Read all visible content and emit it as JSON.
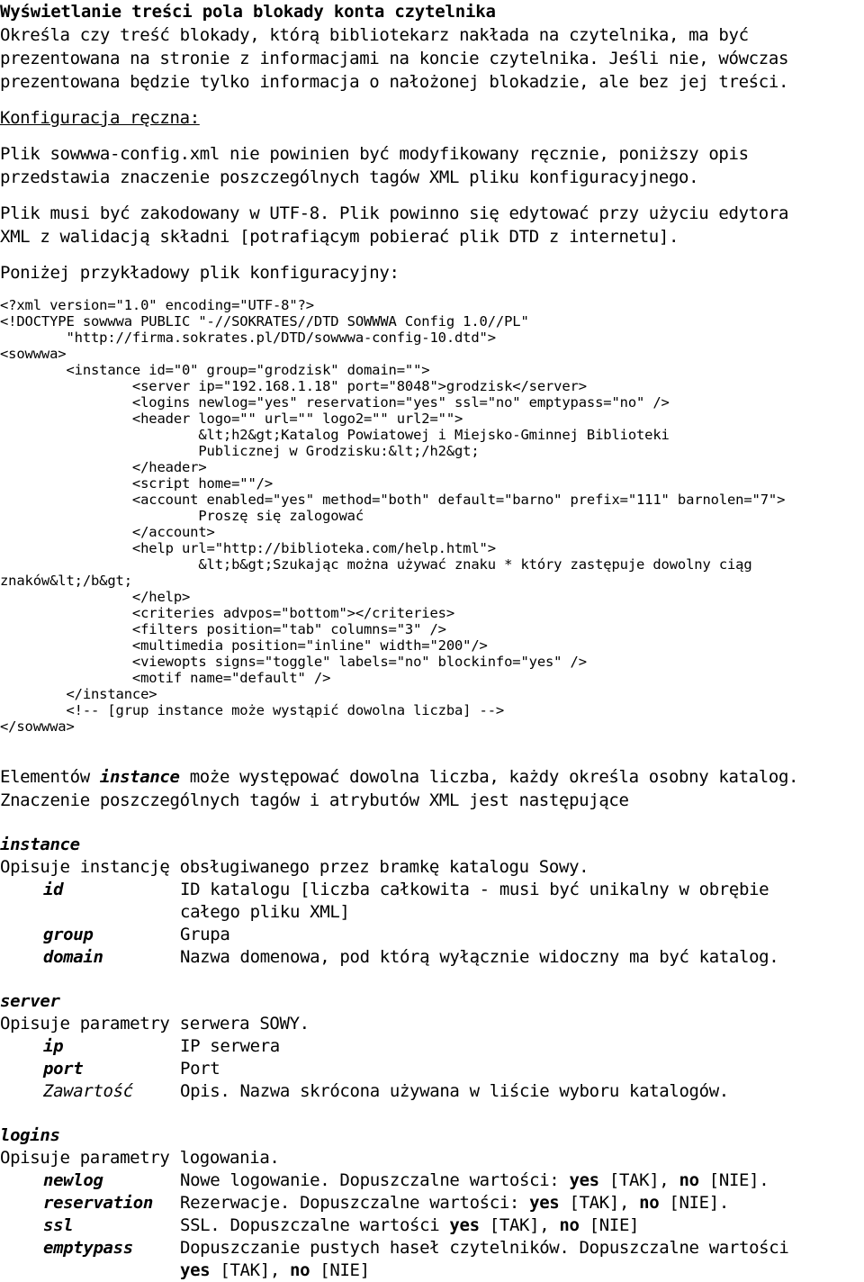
{
  "document": {
    "title": "Wyświetlanie treści pola blokady konta czytelnika",
    "intro_lines": [
      "Określa czy treść blokady, którą bibliotekarz nakłada na czytelnika, ma być",
      "prezentowana na stronie z informacjami na koncie czytelnika. Jeśli nie, wówczas",
      "prezentowana będzie tylko informacja o nałożonej blokadzie, ale bez jej treści."
    ],
    "manual_config_label": "Konfiguracja ręczna:",
    "paragraph_file_lines": [
      "Plik sowwwa-config.xml nie powinien być modyfikowany ręcznie, poniższy opis",
      "przedstawia znaczenie poszczególnych tagów XML pliku konfiguracyjnego."
    ],
    "paragraph_encoding_lines": [
      "Plik musi być zakodowany w UTF-8. Plik powinno się edytować przy użyciu edytora",
      "XML z walidacją składni [potrafiącym pobierać plik DTD z internetu]."
    ],
    "paragraph_example_label": "Poniżej przykładowy plik konfiguracyjny:",
    "code_listing": [
      "<?xml version=\"1.0\" encoding=\"UTF-8\"?>",
      "<!DOCTYPE sowwwa PUBLIC \"-//SOKRATES//DTD SOWWWA Config 1.0//PL\"",
      "        \"http://firma.sokrates.pl/DTD/sowwwa-config-10.dtd\">",
      "<sowwwa>",
      "        <instance id=\"0\" group=\"grodzisk\" domain=\"\">",
      "                <server ip=\"192.168.1.18\" port=\"8048\">grodzisk</server>",
      "                <logins newlog=\"yes\" reservation=\"yes\" ssl=\"no\" emptypass=\"no\" />",
      "                <header logo=\"\" url=\"\" logo2=\"\" url2=\"\">",
      "                        &lt;h2&gt;Katalog Powiatowej i Miejsko-Gminnej Biblioteki",
      "                        Publicznej w Grodzisku:&lt;/h2&gt;",
      "                </header>",
      "                <script home=\"\"/>",
      "                <account enabled=\"yes\" method=\"both\" default=\"barno\" prefix=\"111\" barnolen=\"7\">",
      "                        Proszę się zalogować",
      "                </account>",
      "                <help url=\"http://biblioteka.com/help.html\">",
      "                        &lt;b&gt;Szukając można używać znaku * który zastępuje dowolny ciąg",
      "znaków&lt;/b&gt;",
      "                </help>",
      "                <criteries advpos=\"bottom\"></criteries>",
      "                <filters position=\"tab\" columns=\"3\" />",
      "                <multimedia position=\"inline\" width=\"200\"/>",
      "                <viewopts signs=\"toggle\" labels=\"no\" blockinfo=\"yes\" />",
      "                <motif name=\"default\" />",
      "        </instance>",
      "        <!-- [grup instance może wystąpić dowolna liczba] -->",
      "</sowwwa>"
    ],
    "paragraph_instance_prefix": "Elementów ",
    "paragraph_instance_keyword": "instance",
    "paragraph_instance_suffix": " może występować dowolna liczba, każdy określa osobny katalog.",
    "paragraph_instance_line2": "Znaczenie poszczególnych tagów i atrybutów XML jest następujące",
    "definitions": [
      {
        "name": "instance",
        "intro": "Opisuje instancję obsługiwanego przez bramkę katalogu Sowy.",
        "rows": [
          {
            "term": "id",
            "term_style": "bold-italic",
            "desc": "ID katalogu [liczba całkowita - musi być unikalny w obrębie",
            "cont": "całego pliku XML]"
          },
          {
            "term": "group",
            "term_style": "bold-italic",
            "desc": "Grupa",
            "cont": ""
          },
          {
            "term": "domain",
            "term_style": "bold-italic",
            "desc": "Nazwa domenowa, pod którą wyłącznie widoczny ma być katalog.",
            "cont": ""
          }
        ]
      },
      {
        "name": "server",
        "intro": "Opisuje parametry serwera SOWY.",
        "rows": [
          {
            "term": "ip",
            "term_style": "bold-italic",
            "desc": "IP serwera",
            "cont": ""
          },
          {
            "term": "port",
            "term_style": "bold-italic",
            "desc": "Port",
            "cont": ""
          },
          {
            "term": "Zawartość",
            "term_style": "italic",
            "desc": "Opis. Nazwa skrócona używana w liście wyboru katalogów.",
            "cont": ""
          }
        ]
      },
      {
        "name": "logins",
        "intro": "Opisuje parametry logowania.",
        "rows": [
          {
            "term": "newlog",
            "term_style": "bold-italic",
            "desc_pre": "Nowe logowanie. Dopuszczalne wartości: ",
            "kw1": "yes",
            "desc_mid": " [TAK], ",
            "kw2": "no",
            "desc_post": " [NIE].",
            "cont": ""
          },
          {
            "term": "reservation",
            "term_style": "bold-italic",
            "desc_pre": "Rezerwacje. Dopuszczalne wartości: ",
            "kw1": "yes",
            "desc_mid": " [TAK], ",
            "kw2": "no",
            "desc_post": " [NIE].",
            "cont": ""
          },
          {
            "term": "ssl",
            "term_style": "bold-italic",
            "desc_pre": "SSL. Dopuszczalne wartości ",
            "kw1": "yes",
            "desc_mid": " [TAK], ",
            "kw2": "no",
            "desc_post": " [NIE]",
            "cont": ""
          },
          {
            "term": "emptypass",
            "term_style": "bold-italic",
            "desc_pre": "Dopuszczanie pustych haseł czytelników. Dopuszczalne wartości",
            "kw1": "",
            "desc_mid": "",
            "kw2": "",
            "desc_post": "",
            "cont_pre": "",
            "cont_kw1": "yes",
            "cont_mid": " [TAK], ",
            "cont_kw2": "no",
            "cont_post": " [NIE]"
          }
        ]
      }
    ]
  }
}
